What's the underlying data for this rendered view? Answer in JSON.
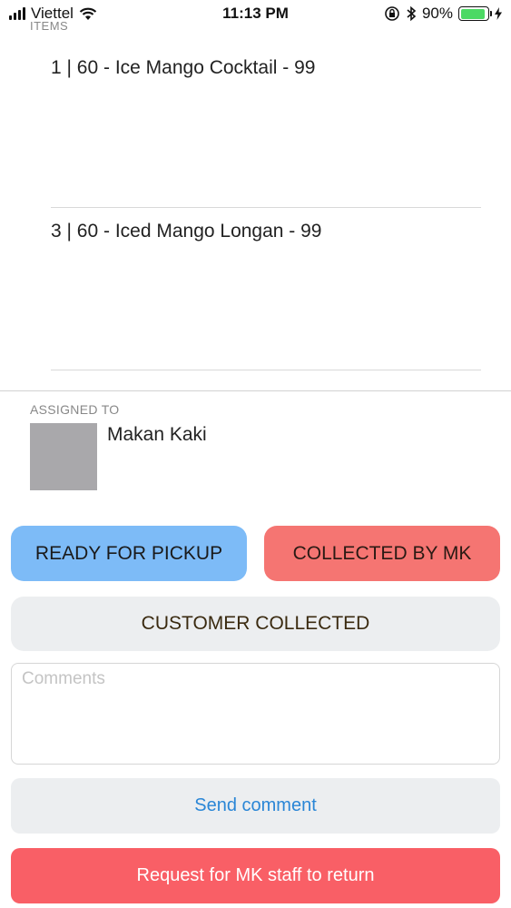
{
  "status_bar": {
    "carrier": "Viettel",
    "time": "11:13 PM",
    "battery_percent": "90%",
    "battery_level": 0.9,
    "icons": [
      "signal-icon",
      "wifi-icon",
      "rotation-lock-icon",
      "bluetooth-icon",
      "battery-icon",
      "charging-icon"
    ]
  },
  "items": {
    "header": "ITEMS",
    "list": [
      {
        "text": "1 | 60 - Ice Mango Cocktail - 99"
      },
      {
        "text": "3 | 60 - Iced Mango Longan - 99"
      }
    ]
  },
  "assigned": {
    "label": "ASSIGNED TO",
    "name": "Makan Kaki"
  },
  "actions": {
    "ready_for_pickup": "READY FOR PICKUP",
    "collected_by_mk": "COLLECTED BY MK",
    "customer_collected": "CUSTOMER COLLECTED"
  },
  "comments": {
    "placeholder": "Comments",
    "value": ""
  },
  "send_comment": "Send comment",
  "request_return": "Request for MK staff to return",
  "colors": {
    "ready_button": "#7dbbf7",
    "collected_mk_button": "#f57572",
    "neutral_button": "#eceef0",
    "link_blue": "#2a86d6",
    "request_button": "#f95f66",
    "battery_green": "#4cd964"
  }
}
